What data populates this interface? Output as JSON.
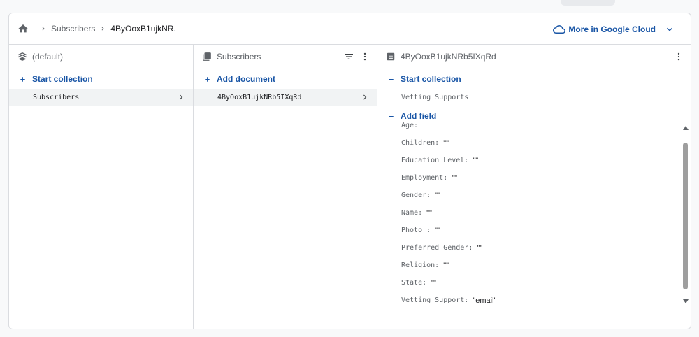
{
  "breadcrumb": {
    "items": [
      "Subscribers",
      "4ByOoxB1ujkNR."
    ]
  },
  "cloud_menu": {
    "label": "More in Google Cloud"
  },
  "columns": {
    "database": {
      "title": "(default)",
      "add_label": "Start collection",
      "items": [
        "Subscribers"
      ]
    },
    "collection": {
      "title": "Subscribers",
      "add_label": "Add document",
      "items": [
        "4ByOoxB1ujkNRb5IXqRd"
      ]
    },
    "document": {
      "title": "4ByOoxB1ujkNRb5IXqRd",
      "add_collection_label": "Start collection",
      "subcollections": [
        "Vetting Supports"
      ],
      "add_field_label": "Add field",
      "fields": [
        {
          "key": "Age:",
          "value": ""
        },
        {
          "key": "Children:",
          "value": "\"\""
        },
        {
          "key": "Education Level:",
          "value": "\"\""
        },
        {
          "key": "Employment:",
          "value": "\"\""
        },
        {
          "key": "Gender:",
          "value": "\"\""
        },
        {
          "key": "Name:",
          "value": "\"\""
        },
        {
          "key": "Photo :",
          "value": "\"\""
        },
        {
          "key": "Preferred Gender:",
          "value": "\"\""
        },
        {
          "key": "Religion:",
          "value": "\"\""
        },
        {
          "key": "State:",
          "value": "\"\""
        },
        {
          "key": "Vetting Support:",
          "value": "\"email\""
        }
      ]
    }
  },
  "colors": {
    "accent": "#1a56a6",
    "text": "#3c4043",
    "border": "#dadce0",
    "selected": "#f1f3f4"
  },
  "icons": [
    "home-icon",
    "chevron-right-icon",
    "cloud-icon",
    "chevron-down-icon",
    "database-icon",
    "collection-icon",
    "filter-icon",
    "more-vert-icon",
    "document-icon",
    "plus-icon"
  ]
}
